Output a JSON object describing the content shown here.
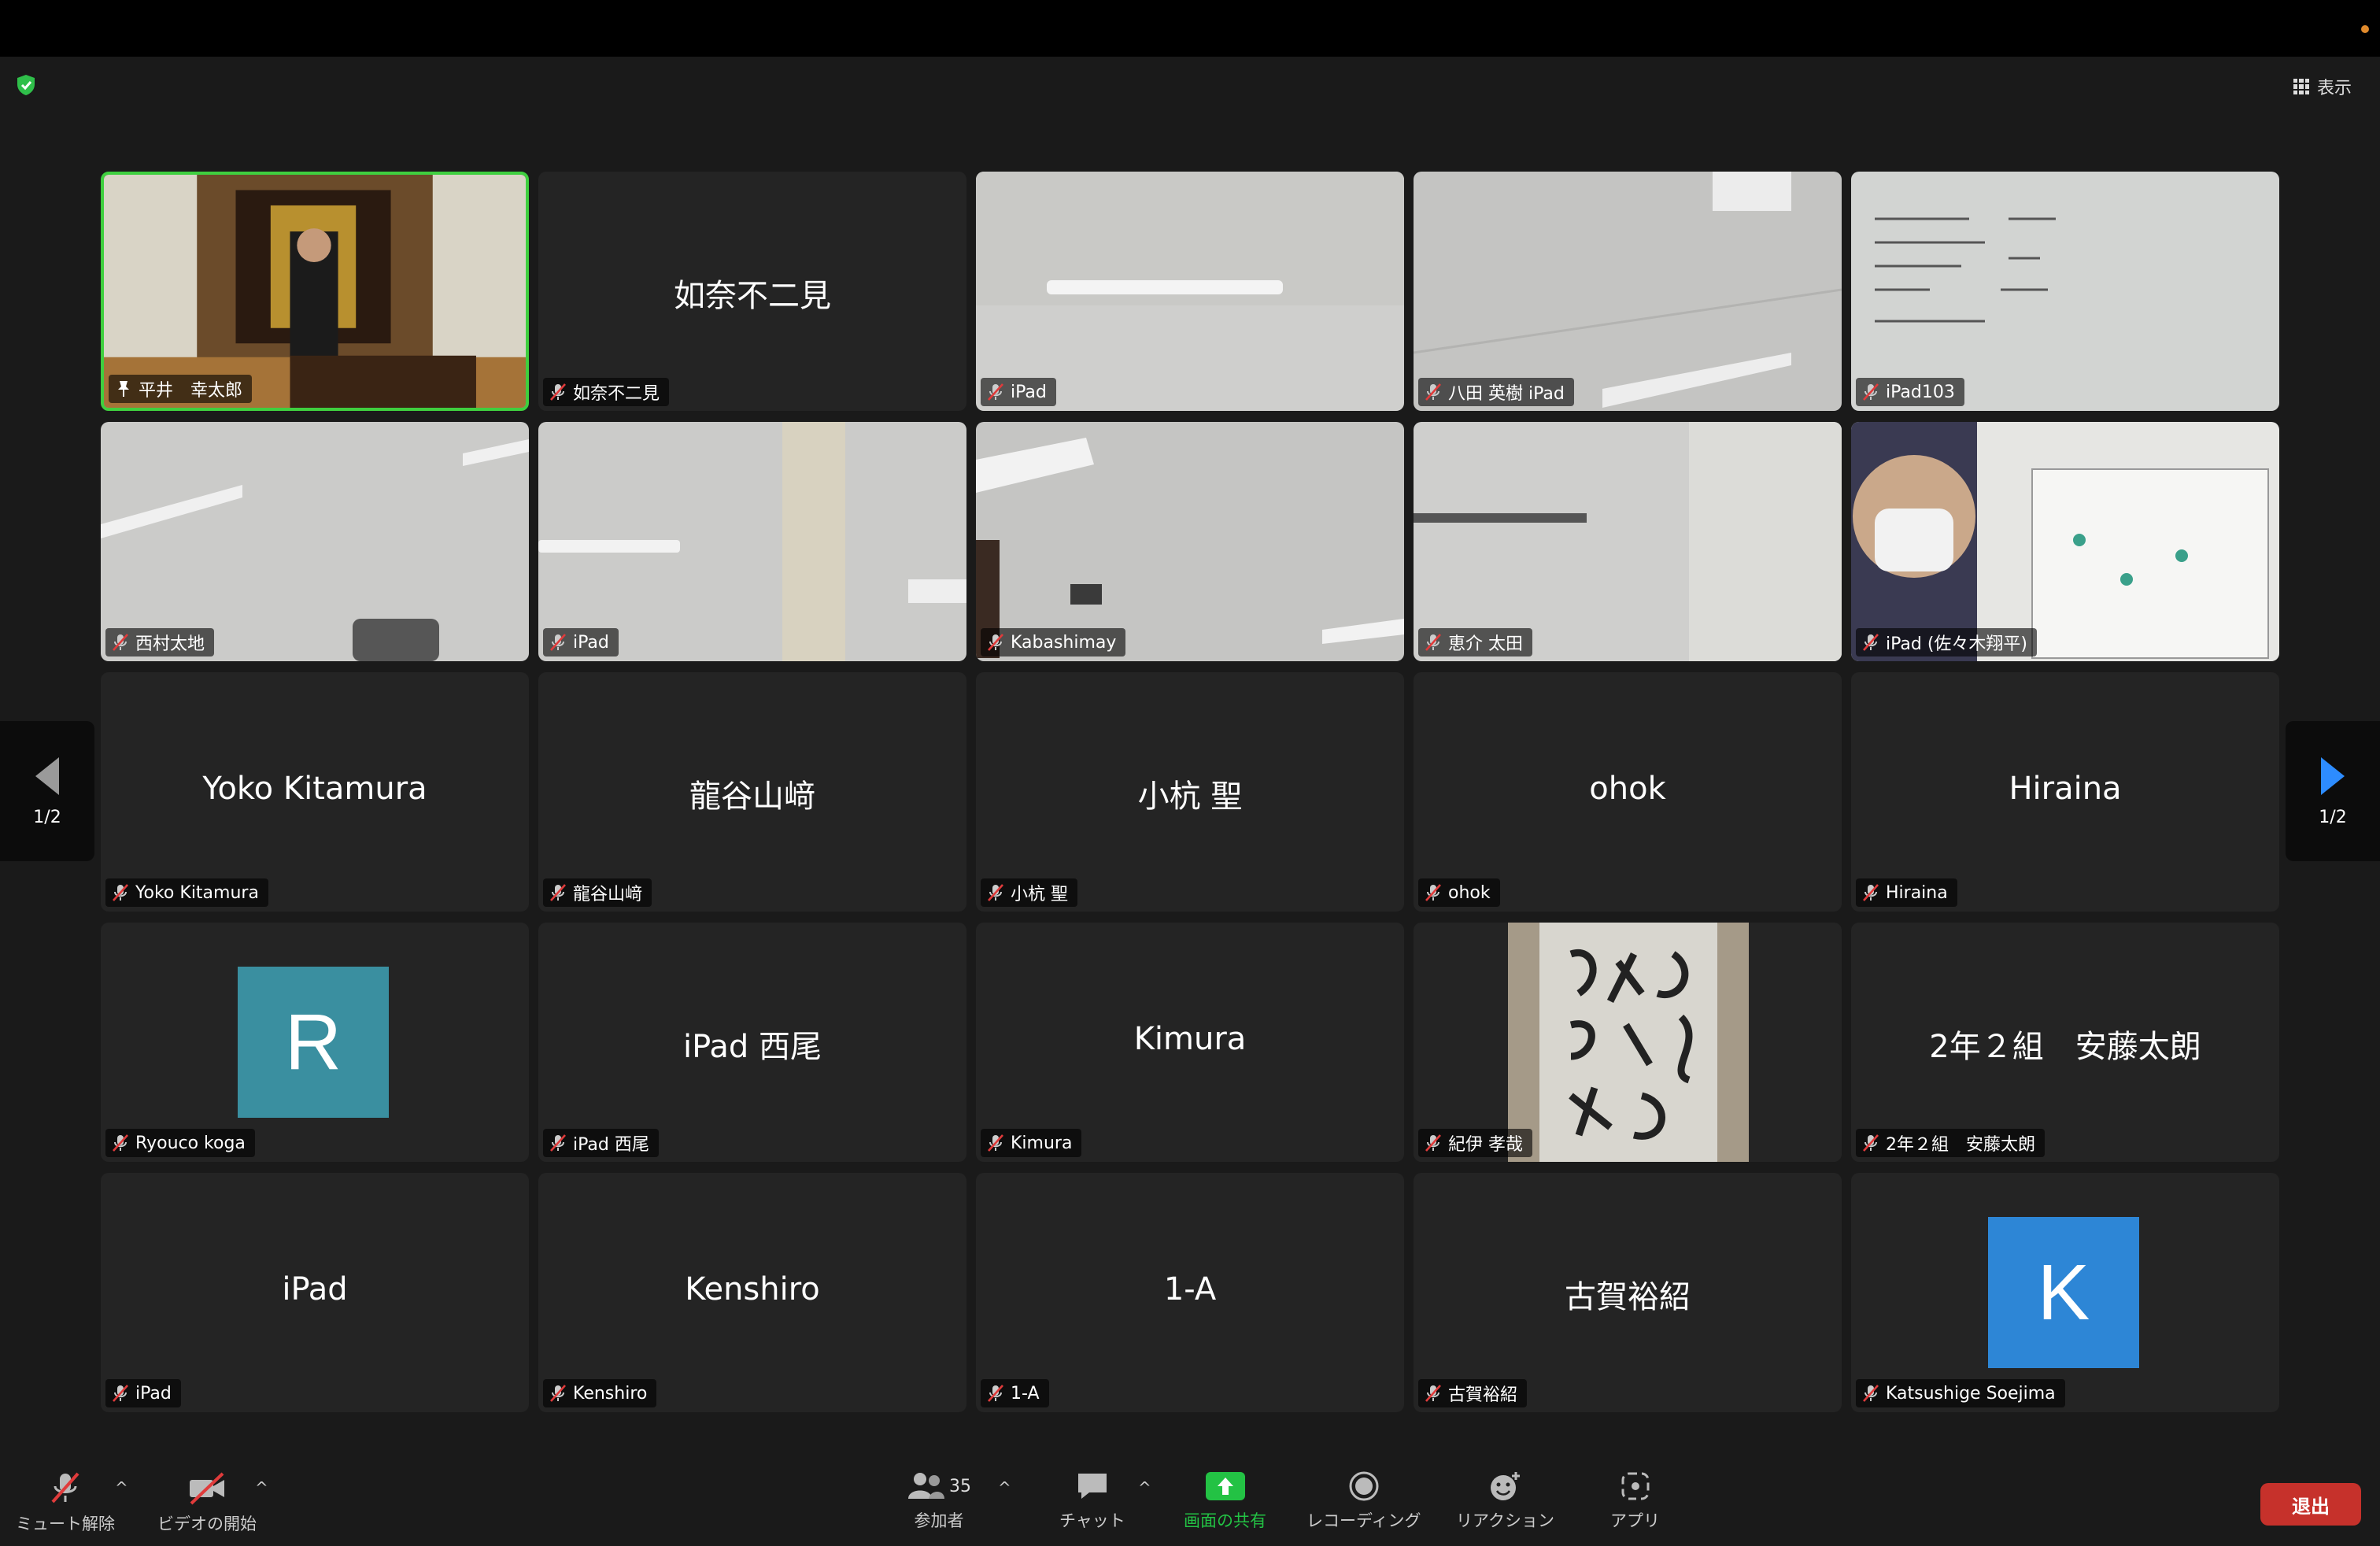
{
  "top": {
    "view_label": "表示"
  },
  "tiles": [
    {
      "name": "平井　幸太郎",
      "pinned": true
    },
    {
      "name": "如奈不二見",
      "big": "如奈不二見"
    },
    {
      "name": "iPad"
    },
    {
      "name": "八田 英樹 iPad"
    },
    {
      "name": "iPad103"
    },
    {
      "name": "西村太地"
    },
    {
      "name": "iPad"
    },
    {
      "name": "Kabashimay"
    },
    {
      "name": "恵介 太田"
    },
    {
      "name": "iPad (佐々木翔平)"
    },
    {
      "name": "Yoko Kitamura",
      "big": "Yoko Kitamura"
    },
    {
      "name": "龍谷山﨑",
      "big": "龍谷山﨑"
    },
    {
      "name": "小杭 聖",
      "big": "小杭 聖"
    },
    {
      "name": "ohok",
      "big": "ohok"
    },
    {
      "name": "Hiraina",
      "big": "Hiraina"
    },
    {
      "name": "Ryouco koga",
      "avatar": "R"
    },
    {
      "name": "iPad 西尾",
      "big": "iPad 西尾"
    },
    {
      "name": "Kimura",
      "big": "Kimura"
    },
    {
      "name": "紀伊 孝哉"
    },
    {
      "name": "2年２組　安藤太朗",
      "big": "2年２組　安藤太朗"
    },
    {
      "name": "iPad",
      "big": "iPad"
    },
    {
      "name": "Kenshiro",
      "big": "Kenshiro"
    },
    {
      "name": "1-A",
      "big": "1-A"
    },
    {
      "name": "古賀裕紹",
      "big": "古賀裕紹"
    },
    {
      "name": "Katsushige Soejima",
      "avatar": "K"
    }
  ],
  "pager": {
    "left_label": "1/2",
    "right_label": "1/2"
  },
  "toolbar": {
    "unmute": "ミュート解除",
    "start_video": "ビデオの開始",
    "participants": "参加者",
    "participant_count": "35",
    "chat": "チャット",
    "share": "画面の共有",
    "record": "レコーディング",
    "reactions": "リアクション",
    "apps": "アプリ",
    "leave": "退出"
  },
  "colors": {
    "active_border": "#3fcf3f",
    "share_green": "#23c244",
    "leave_red": "#c6312b",
    "avatar_r": "#3a8fa0",
    "avatar_k": "#2d86d6",
    "pager_arrow": "#2d8cff"
  }
}
